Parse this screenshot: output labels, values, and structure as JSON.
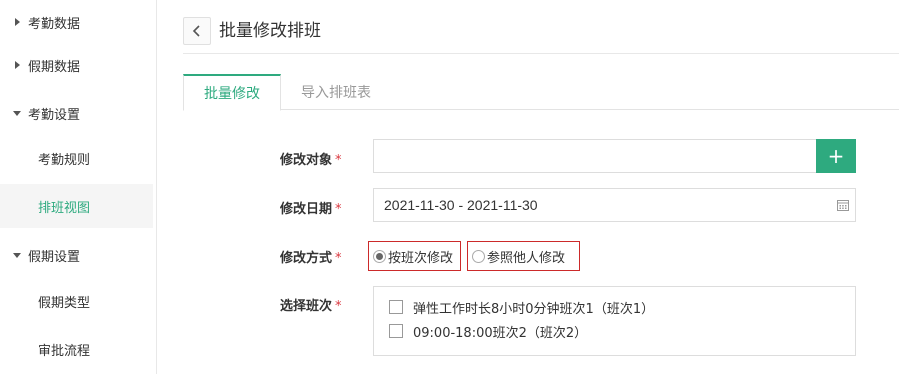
{
  "sidebar": {
    "items": [
      {
        "label": "考勤数据",
        "type": "group",
        "expanded": false
      },
      {
        "label": "假期数据",
        "type": "group",
        "expanded": false
      },
      {
        "label": "考勤设置",
        "type": "group",
        "expanded": true
      },
      {
        "label": "考勤规则",
        "type": "sub",
        "active": false
      },
      {
        "label": "排班视图",
        "type": "sub",
        "active": true
      },
      {
        "label": "假期设置",
        "type": "group",
        "expanded": true
      },
      {
        "label": "假期类型",
        "type": "sub",
        "active": false
      },
      {
        "label": "审批流程",
        "type": "sub",
        "active": false
      }
    ]
  },
  "header": {
    "back_icon": "chevron-left-icon",
    "title": "批量修改排班"
  },
  "tabs": [
    {
      "label": "批量修改",
      "active": true
    },
    {
      "label": "导入排班表",
      "active": false
    }
  ],
  "form": {
    "required_mark": "*",
    "target": {
      "label": "修改对象",
      "value": "",
      "add_icon": "plus-icon",
      "add_symbol": "+"
    },
    "date": {
      "label": "修改日期",
      "value": "2021-11-30 - 2021-11-30",
      "icon": "calendar-icon"
    },
    "method": {
      "label": "修改方式",
      "options": [
        {
          "label": "按班次修改",
          "selected": true
        },
        {
          "label": "参照他人修改",
          "selected": false
        }
      ]
    },
    "shift": {
      "label": "选择班次",
      "options": [
        {
          "label": "弹性工作时长8小时0分钟班次1（班次1）",
          "checked": false
        },
        {
          "label": "09:00-18:00班次2（班次2）",
          "checked": false
        }
      ]
    }
  },
  "colors": {
    "accent": "#2eaa7f",
    "required": "#d9363e",
    "highlight_border": "#cc2a2a"
  }
}
